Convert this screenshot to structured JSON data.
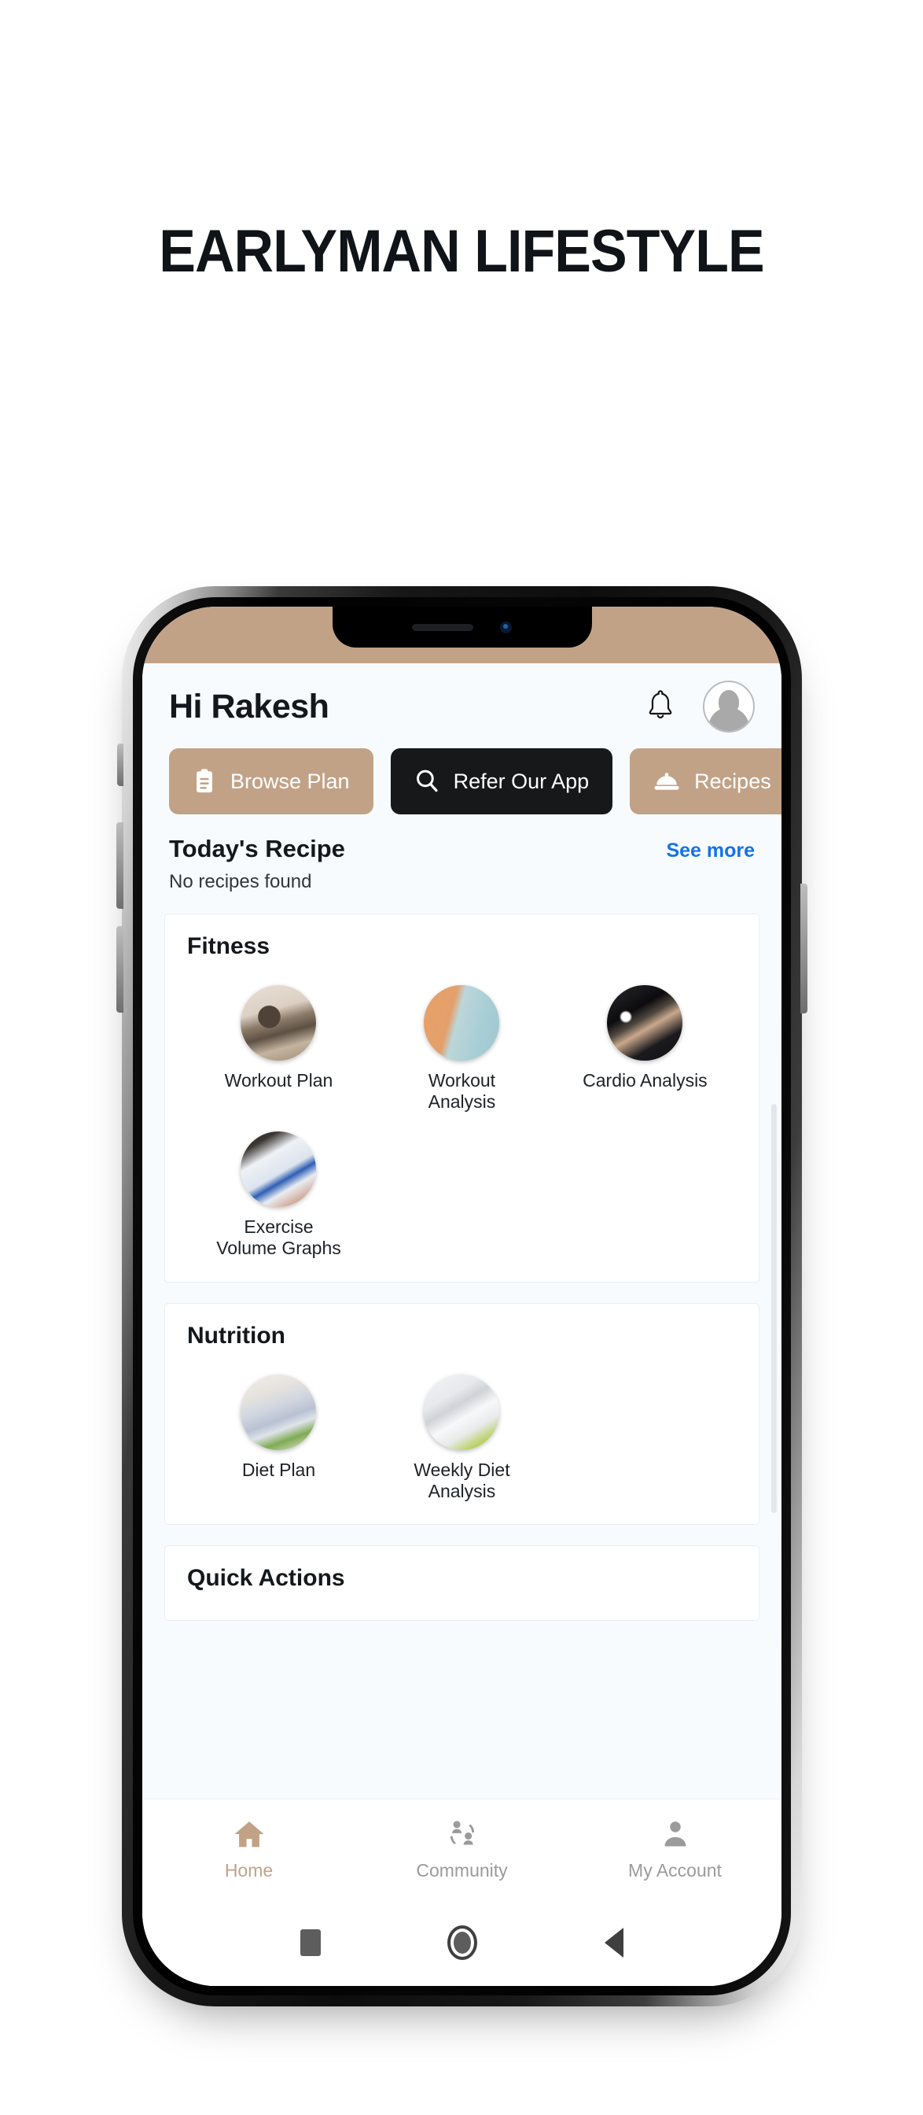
{
  "banner": {
    "title": "EARLYMAN LIFESTYLE"
  },
  "colors": {
    "accent_tan": "#c2a287",
    "dark_button": "#16181a",
    "link_blue": "#1273e6",
    "screen_bg": "#f8fbfd",
    "card_bg": "#ffffff"
  },
  "app": {
    "header": {
      "greeting": "Hi Rakesh",
      "bell_icon": "bell-icon",
      "avatar_icon": "avatar-person-icon"
    },
    "quick_buttons": [
      {
        "label": "Browse Plan",
        "icon": "clipboard-icon",
        "style": "tan"
      },
      {
        "label": "Refer Our App",
        "icon": "search-icon",
        "style": "dark"
      },
      {
        "label": "Recipes",
        "icon": "food-dome-icon",
        "style": "tan"
      }
    ],
    "todays_recipe": {
      "title": "Today's Recipe",
      "see_more": "See more",
      "empty_text": "No recipes found"
    },
    "sections": [
      {
        "title": "Fitness",
        "tiles": [
          {
            "label": "Workout Plan",
            "photo": "ph-workout-plan"
          },
          {
            "label": "Workout Analysis",
            "photo": "ph-workout-analysis"
          },
          {
            "label": "Cardio Analysis",
            "photo": "ph-cardio"
          },
          {
            "label": "Exercise Volume Graphs",
            "photo": "ph-exercise-graph"
          }
        ]
      },
      {
        "title": "Nutrition",
        "tiles": [
          {
            "label": "Diet Plan",
            "photo": "ph-diet-plan"
          },
          {
            "label": "Weekly Diet Analysis",
            "photo": "ph-weekly-diet"
          }
        ]
      },
      {
        "title": "Quick Actions",
        "tiles": []
      }
    ],
    "bottom_nav": [
      {
        "label": "Home",
        "icon": "home-icon",
        "active": true
      },
      {
        "label": "Community",
        "icon": "community-icon",
        "active": false
      },
      {
        "label": "My Account",
        "icon": "person-icon",
        "active": false
      }
    ],
    "system_bar": [
      {
        "icon": "recents-square-icon"
      },
      {
        "icon": "home-circle-icon"
      },
      {
        "icon": "back-triangle-icon"
      }
    ]
  }
}
